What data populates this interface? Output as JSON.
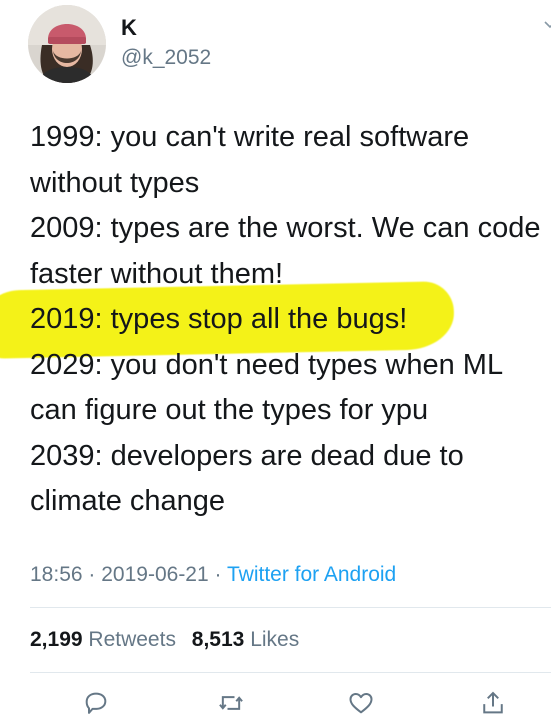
{
  "user": {
    "display_name": "K",
    "handle": "@k_2052"
  },
  "tweet": {
    "lines": [
      "1999: you can't write real software",
      "without types",
      "2009: types are the worst. We can code",
      "faster without them!",
      "2019: types stop all the bugs!",
      "2029: you don't need types when ML",
      "can figure out the types for ypu",
      "2039: developers are dead due to",
      "climate change"
    ],
    "highlighted_line": "2019: types stop all the bugs!",
    "highlight_color": "#f4f218"
  },
  "meta": {
    "time": "18:56",
    "separator": "·",
    "date": "2019-06-21",
    "source": "Twitter for Android"
  },
  "stats": {
    "retweets_count": "2,199",
    "retweets_label": "Retweets",
    "likes_count": "8,513",
    "likes_label": "Likes"
  },
  "actions": {
    "reply_icon": "reply-icon",
    "retweet_icon": "retweet-icon",
    "like_icon": "like-icon",
    "share_icon": "share-icon"
  },
  "colors": {
    "text": "#14171a",
    "secondary": "#657786",
    "link": "#1da1f2",
    "divider": "#e1e8ed"
  }
}
